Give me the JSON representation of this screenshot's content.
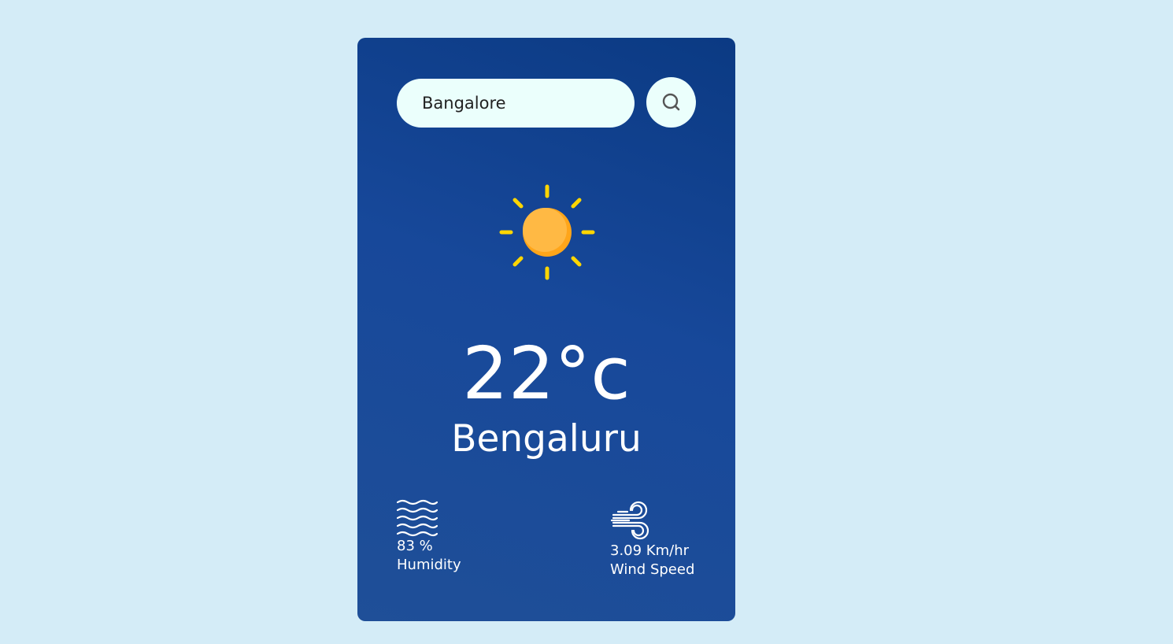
{
  "search": {
    "value": "Bangalore",
    "icon": "search-icon"
  },
  "weather": {
    "icon": "sun-icon",
    "temperature": "22°c",
    "city": "Bengaluru"
  },
  "humidity": {
    "icon": "humidity-waves-icon",
    "value": "83 %",
    "label": "Humidity"
  },
  "wind": {
    "icon": "wind-icon",
    "value": "3.09 Km/hr",
    "label": "Wind Speed"
  },
  "colors": {
    "background": "#d4ecf7",
    "card": "#17489a",
    "input": "#ebfffc",
    "sun": "#ffb43c",
    "sun_rays": "#ffd600"
  }
}
